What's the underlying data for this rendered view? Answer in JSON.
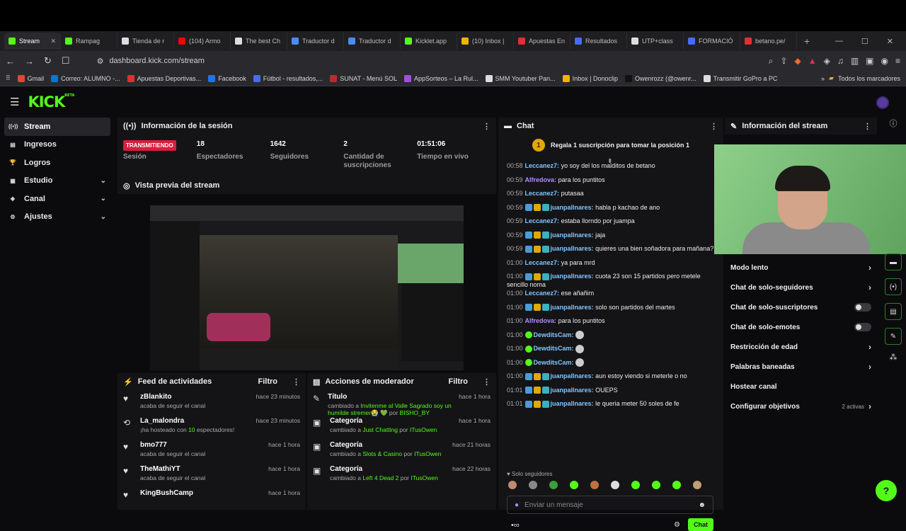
{
  "tabs": [
    {
      "label": "Stream",
      "color": "#53fc18",
      "active": true
    },
    {
      "label": "Rampag",
      "color": "#53fc18"
    },
    {
      "label": "Tienda de r",
      "color": "#dddddd"
    },
    {
      "label": "(104) Armo",
      "color": "#ff0000"
    },
    {
      "label": "The best Ch",
      "color": "#dddddd"
    },
    {
      "label": "Traductor d",
      "color": "#4a8cff"
    },
    {
      "label": "Traductor d",
      "color": "#4a8cff"
    },
    {
      "label": "Kicklet.app",
      "color": "#53fc18"
    },
    {
      "label": "(10) Inbox |",
      "color": "#f0b400"
    },
    {
      "label": "Apuestas En",
      "color": "#e03030"
    },
    {
      "label": "Resultados",
      "color": "#4a6aff"
    },
    {
      "label": "UTP+class",
      "color": "#dddddd"
    },
    {
      "label": "FORMACIÓ",
      "color": "#4a6aff"
    },
    {
      "label": "betano.pe/",
      "color": "#e03030"
    }
  ],
  "address": {
    "url": "dashboard.kick.com/stream"
  },
  "bookmarks": [
    {
      "label": "Gmail",
      "color": "#ea4335"
    },
    {
      "label": "Correo: ALUMNO -...",
      "color": "#0078d4"
    },
    {
      "label": "Apuestas Deportivas...",
      "color": "#e03030"
    },
    {
      "label": "Facebook",
      "color": "#1877f2"
    },
    {
      "label": "Fútbol - resultados,...",
      "color": "#4a6aff"
    },
    {
      "label": "SUNAT - Menú SOL",
      "color": "#c0282d"
    },
    {
      "label": "AppSorteos – La Rul...",
      "color": "#a050e0"
    },
    {
      "label": "SMM Youtuber Pan...",
      "color": "#dddddd"
    },
    {
      "label": "Inbox | Donoclip",
      "color": "#f0b400"
    },
    {
      "label": "Owenrozz (@owenr...",
      "color": "#111111"
    },
    {
      "label": "Transmitir GoPro a PC",
      "color": "#dddddd"
    }
  ],
  "bookmarks_all": "Todos los marcadores",
  "logo": {
    "text": "KICK",
    "sup": "BETA"
  },
  "sidebar": [
    {
      "label": "Stream",
      "icon": "broadcast-icon",
      "glyph": "((•))",
      "active": true
    },
    {
      "label": "Ingresos",
      "icon": "wallet-icon",
      "glyph": "▤"
    },
    {
      "label": "Logros",
      "icon": "trophy-icon",
      "glyph": "🏆"
    },
    {
      "label": "Estudio",
      "icon": "studio-icon",
      "glyph": "▦",
      "expand": true
    },
    {
      "label": "Canal",
      "icon": "channel-icon",
      "glyph": "◈",
      "expand": true
    },
    {
      "label": "Ajustes",
      "icon": "gear-icon",
      "glyph": "⚙",
      "expand": true
    }
  ],
  "session": {
    "title": "Información de la sesión",
    "status": "TRANSMITIENDO",
    "status_label": "Sesión",
    "stats": [
      {
        "value": "18",
        "label": "Espectadores"
      },
      {
        "value": "1642",
        "label": "Seguidores"
      },
      {
        "value": "2",
        "label": "Cantidad de suscripciones"
      },
      {
        "value": "01:51:06",
        "label": "Tiempo en vivo"
      }
    ]
  },
  "preview": {
    "title": "Vista previa del stream"
  },
  "feed": {
    "title": "Feed de actividades",
    "filter": "Filtro",
    "items": [
      {
        "icon": "heart-icon",
        "glyph": "♥",
        "name": "zBlankito",
        "desc": "acaba de seguir el canal",
        "time": "hace 23 minutos"
      },
      {
        "icon": "host-icon",
        "glyph": "⟲",
        "name": "La_malondra",
        "desc_pre": "¡ha hosteado con ",
        "desc_hl": "10",
        "desc_post": " espectadores!",
        "time": "hace 23 minutos"
      },
      {
        "icon": "heart-icon",
        "glyph": "♥",
        "name": "bmo777",
        "desc": "acaba de seguir el canal",
        "time": "hace 1 hora"
      },
      {
        "icon": "heart-icon",
        "glyph": "♥",
        "name": "TheMathiYT",
        "desc": "acaba de seguir el canal",
        "time": "hace 1 hora"
      },
      {
        "icon": "heart-icon",
        "glyph": "♥",
        "name": "KingBushCamp",
        "desc": "",
        "time": "hace 1 hora"
      }
    ]
  },
  "mod": {
    "title": "Acciones de moderador",
    "filter": "Filtro",
    "items": [
      {
        "glyph": "✎",
        "icon": "title-icon",
        "name": "Título",
        "pre": "cambiado a ",
        "hl": "Invitenme al Valle Sagrado soy un humilde stremer😭 💚",
        "mid": " por ",
        "by": "BISHO_BY",
        "time": "hace 1 hora"
      },
      {
        "glyph": "▣",
        "icon": "category-icon",
        "name": "Categoría",
        "pre": "cambiado a ",
        "hl": "Just Chatting",
        "mid": " por ",
        "by": "ITusOwen",
        "time": "hace 1 hora"
      },
      {
        "glyph": "▣",
        "icon": "category-icon",
        "name": "Categoría",
        "pre": "cambiado a ",
        "hl": "Slots & Casino",
        "mid": " por ",
        "by": "ITusOwen",
        "time": "hace 21 horas"
      },
      {
        "glyph": "▣",
        "icon": "category-icon",
        "name": "Categoría",
        "pre": "cambiado a ",
        "hl": "Left 4 Dead 2",
        "mid": " por ",
        "by": "ITusOwen",
        "time": "hace 22 horas"
      }
    ]
  },
  "chat": {
    "title": "Chat",
    "pinned_rank": "1",
    "pinned": "Regala 1 suscripción para tomar la posición 1",
    "messages": [
      {
        "t": "00:58",
        "u": "Leccanez7:",
        "c": "u1",
        "m": "yo soy del los malditos de betano"
      },
      {
        "t": "00:59",
        "u": "Alfredova:",
        "c": "u2",
        "m": "para los puntitos"
      },
      {
        "t": "00:59",
        "u": "Leccanez7:",
        "c": "u1",
        "m": "putasaa"
      },
      {
        "t": "00:59",
        "u": "juanpallnares:",
        "c": "u1",
        "badges": true,
        "m": "habla p kachao de ano"
      },
      {
        "t": "00:59",
        "u": "Leccanez7:",
        "c": "u1",
        "m": "estaba llorndo por juampa"
      },
      {
        "t": "00:59",
        "u": "juanpallnares:",
        "c": "u1",
        "badges": true,
        "m": "jaja"
      },
      {
        "t": "00:59",
        "u": "juanpallnares:",
        "c": "u1",
        "badges": true,
        "m": "quieres una bien soñadora para mañana?"
      },
      {
        "t": "01:00",
        "u": "Leccanez7:",
        "c": "u1",
        "m": "ya para mrd"
      },
      {
        "t": "01:00",
        "u": "juanpallnares:",
        "c": "u1",
        "badges": true,
        "m": "cuota 23 son 15 partidos pero metele sencillo noma"
      },
      {
        "t": "01:00",
        "u": "Leccanez7:",
        "c": "u1",
        "m": "ese añañim"
      },
      {
        "t": "01:00",
        "u": "juanpallnares:",
        "c": "u1",
        "badges": true,
        "m": "solo son partidos del martes"
      },
      {
        "t": "01:00",
        "u": "Alfredova:",
        "c": "u2",
        "m": "para los puntitos"
      },
      {
        "t": "01:00",
        "u": "DewditsCam:",
        "c": "u1",
        "sub": true,
        "emote": true,
        "m": ""
      },
      {
        "t": "01:00",
        "u": "DewditsCam:",
        "c": "u1",
        "sub": true,
        "emote": true,
        "m": ""
      },
      {
        "t": "01:00",
        "u": "DewditsCam:",
        "c": "u1",
        "sub": true,
        "emote": true,
        "m": ""
      },
      {
        "t": "01:00",
        "u": "juanpallnares:",
        "c": "u1",
        "badges": true,
        "m": "aun estoy viendo si meterle o no"
      },
      {
        "t": "01:01",
        "u": "juanpallnares:",
        "c": "u1",
        "badges": true,
        "m": "OUEPS"
      },
      {
        "t": "01:01",
        "u": "juanpallnares:",
        "c": "u1",
        "badges": true,
        "m": "le queria meter 50 soles de fe"
      }
    ],
    "followers_only": "Solo seguidores",
    "input_placeholder": "Enviar un mensaje",
    "send": "Chat"
  },
  "stream_info": {
    "title": "Información del stream",
    "settings": [
      {
        "label": "Modo lento",
        "type": "chevron"
      },
      {
        "label": "Chat de solo-seguidores",
        "type": "chevron"
      },
      {
        "label": "Chat de solo-suscriptores",
        "type": "toggle"
      },
      {
        "label": "Chat de solo-emotes",
        "type": "toggle"
      },
      {
        "label": "Restricción de edad",
        "type": "chevron"
      },
      {
        "label": "Palabras baneadas",
        "type": "chevron"
      },
      {
        "label": "Hostear canal",
        "type": "none"
      },
      {
        "label": "Configurar objetivos",
        "type": "chevron",
        "extra": "2 activas"
      }
    ]
  }
}
